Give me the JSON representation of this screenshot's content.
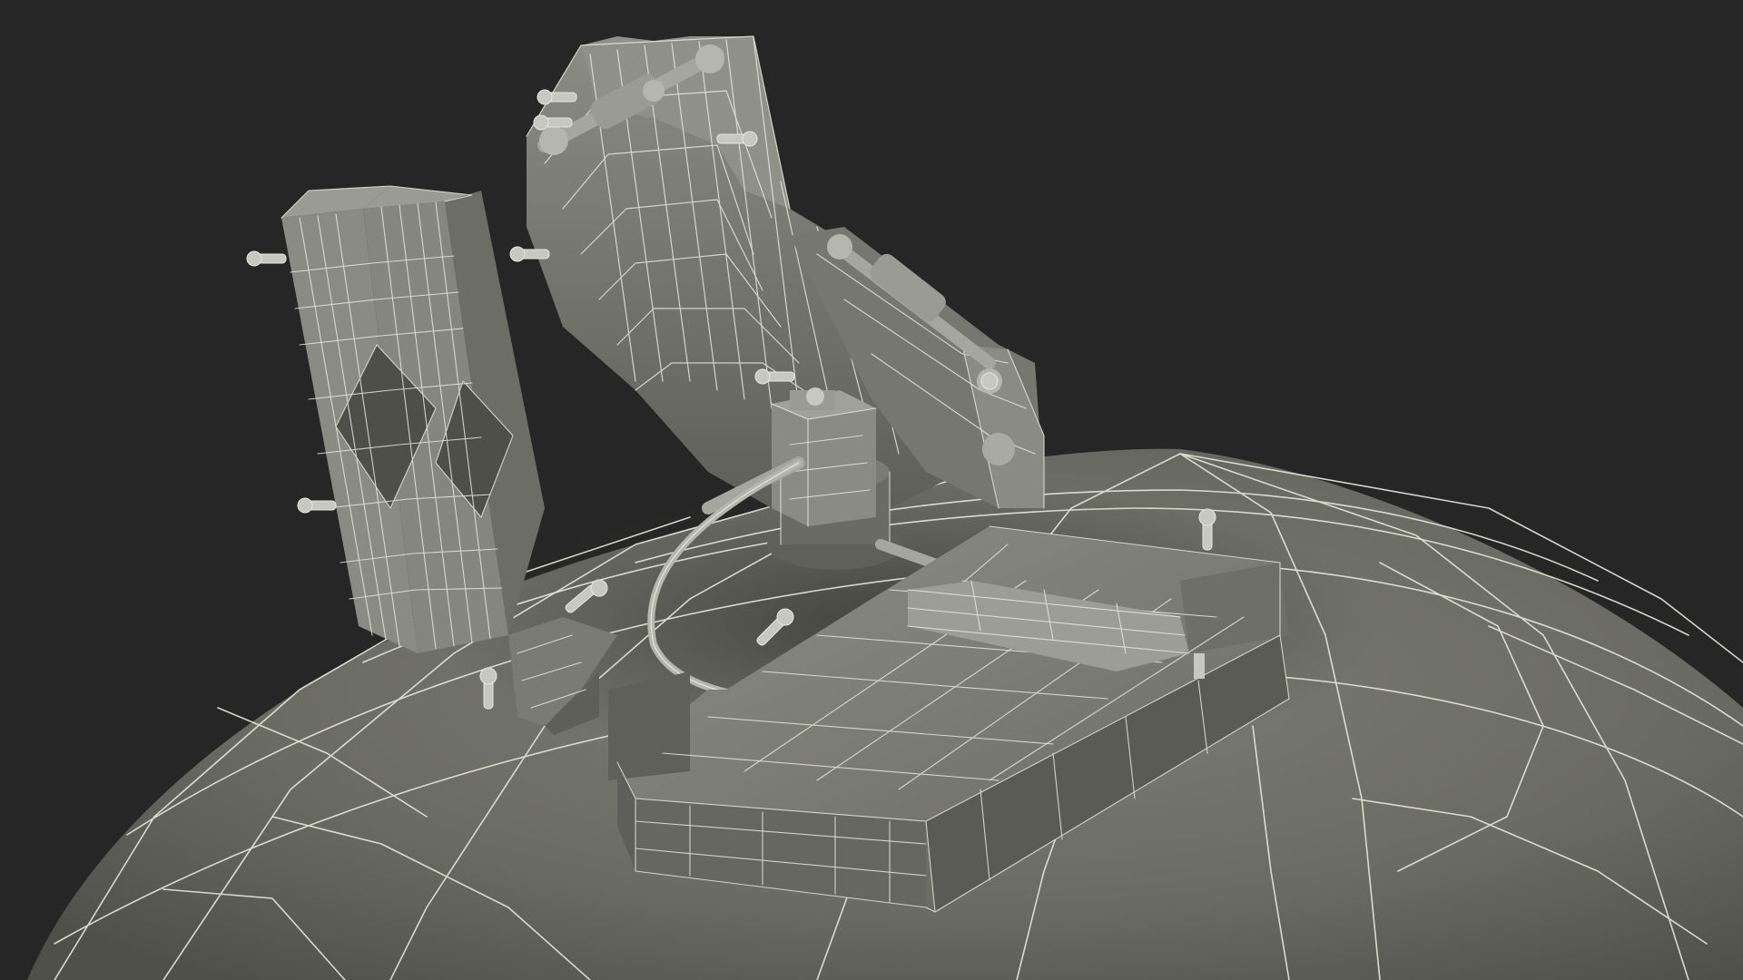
{
  "scene": {
    "subject": "wireframe-3d-model",
    "colors": {
      "background": "#262626",
      "surface": "#6e6f67",
      "surface_light": "#8a8b82",
      "surface_dark": "#55564f",
      "wire": "#e6e8d8",
      "shadow": "#3a3b36"
    }
  }
}
